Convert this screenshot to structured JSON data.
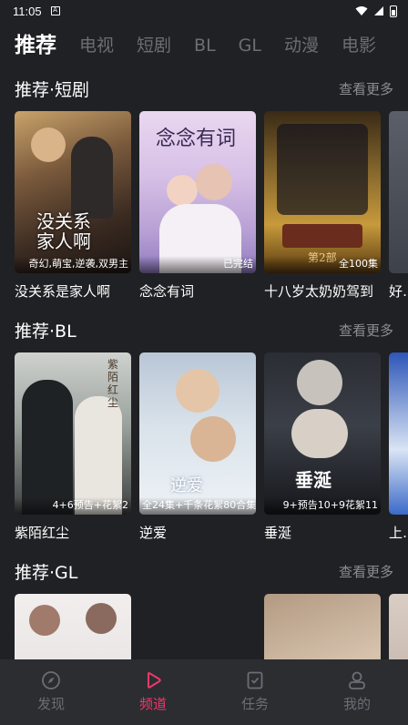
{
  "status_bar": {
    "time": "11:05",
    "notif_icon": "A"
  },
  "top_tabs": [
    {
      "label": "推荐",
      "active": true
    },
    {
      "label": "电视",
      "active": false
    },
    {
      "label": "短剧",
      "active": false
    },
    {
      "label": "BL",
      "active": false
    },
    {
      "label": "GL",
      "active": false
    },
    {
      "label": "动漫",
      "active": false
    },
    {
      "label": "电影",
      "active": false
    }
  ],
  "sections": [
    {
      "title": "推荐·短剧",
      "more": "查看更多",
      "cards": [
        {
          "title": "没关系是家人啊",
          "badge": "奇幻,萌宝,逆袭,双男主",
          "art": "没关系\n家人啊"
        },
        {
          "title": "念念有词",
          "badge": "已完结",
          "art": "念念有词"
        },
        {
          "title": "十八岁太奶奶驾到",
          "badge": "全100集",
          "art": "第2部"
        },
        {
          "title": "好…",
          "badge": "",
          "art": ""
        }
      ]
    },
    {
      "title": "推荐·BL",
      "more": "查看更多",
      "cards": [
        {
          "title": "紫陌红尘",
          "badge": "4+6预告+花絮2",
          "art": "紫陌红尘"
        },
        {
          "title": "逆爱",
          "badge": "全24集+千条花絮80合集",
          "art": "逆爱"
        },
        {
          "title": "垂涎",
          "badge": "9+预告10+9花絮11",
          "art": "垂涎"
        },
        {
          "title": "上…",
          "badge": "",
          "art": ""
        }
      ]
    },
    {
      "title": "推荐·GL",
      "more": "查看更多",
      "cards": [
        {
          "title": "",
          "badge": "",
          "art": ""
        },
        {
          "title": "",
          "badge": "",
          "art": ""
        },
        {
          "title": "",
          "badge": "",
          "art": ""
        }
      ]
    }
  ],
  "bottom_nav": [
    {
      "label": "发现",
      "icon": "compass-icon",
      "active": false
    },
    {
      "label": "频道",
      "icon": "play-icon",
      "active": true
    },
    {
      "label": "任务",
      "icon": "task-icon",
      "active": false
    },
    {
      "label": "我的",
      "icon": "profile-icon",
      "active": false
    }
  ],
  "colors": {
    "background": "#202124",
    "accent": "#f0386a",
    "muted": "#6b6e75",
    "nav_bg": "#2b2d31"
  }
}
